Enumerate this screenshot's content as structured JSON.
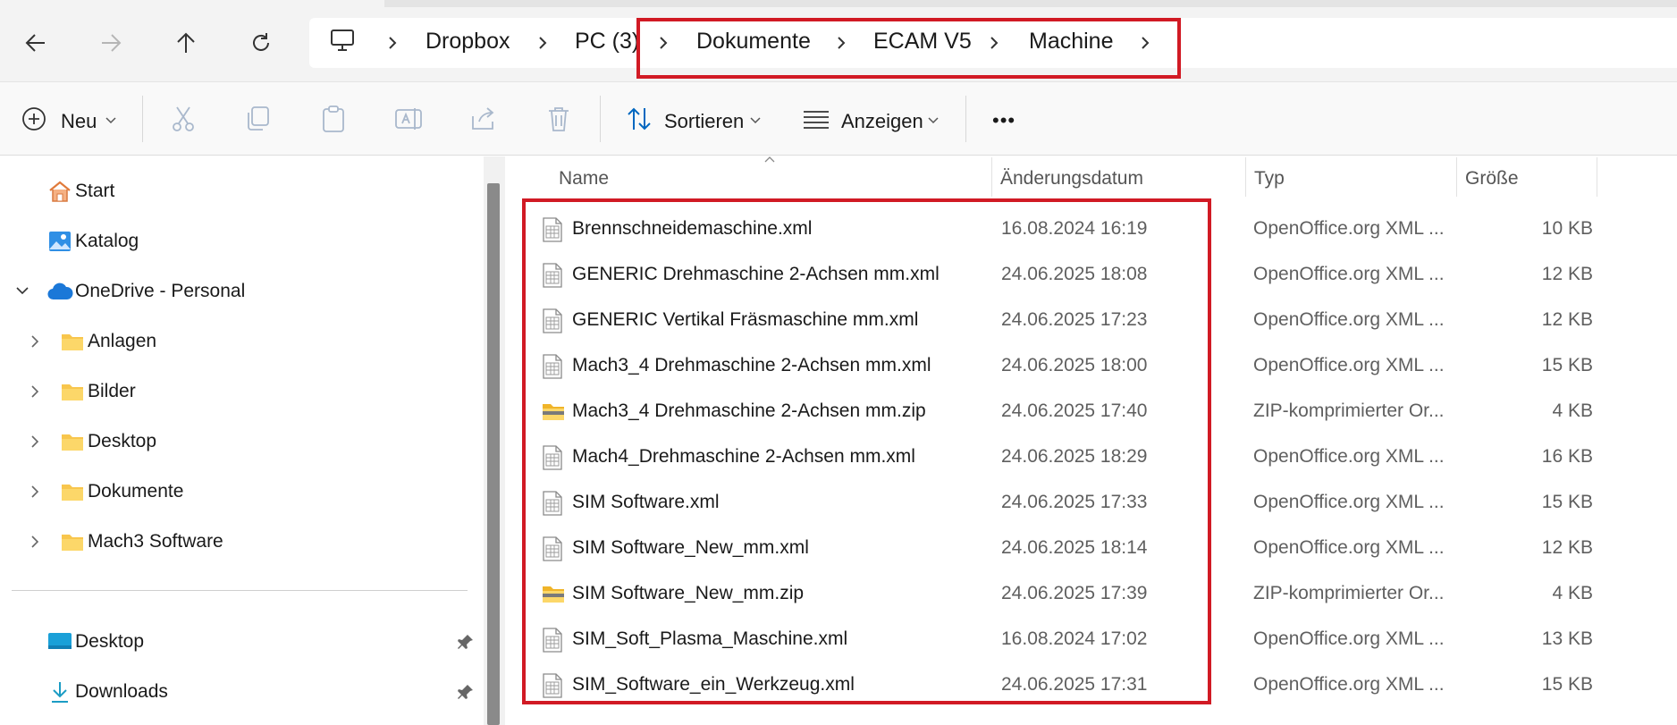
{
  "breadcrumb": [
    "Dropbox",
    "PC (3)",
    "Dokumente",
    "ECAM V5",
    "Machine"
  ],
  "toolbar": {
    "new_label": "Neu",
    "sort_label": "Sortieren",
    "view_label": "Anzeigen",
    "more_label": "•••"
  },
  "sidebar": {
    "items": [
      {
        "label": "Start",
        "icon": "home-icon"
      },
      {
        "label": "Katalog",
        "icon": "gallery-icon"
      },
      {
        "label": "OneDrive - Personal",
        "icon": "onedrive-cloud-icon"
      },
      {
        "label": "Anlagen",
        "icon": "folder-icon"
      },
      {
        "label": "Bilder",
        "icon": "folder-icon"
      },
      {
        "label": "Desktop",
        "icon": "folder-icon"
      },
      {
        "label": "Dokumente",
        "icon": "folder-icon"
      },
      {
        "label": "Mach3 Software",
        "icon": "folder-icon"
      }
    ],
    "quick_access": [
      {
        "label": "Desktop",
        "icon": "desktop-icon",
        "pinned": true
      },
      {
        "label": "Downloads",
        "icon": "download-icon",
        "pinned": true
      }
    ]
  },
  "columns": {
    "name": "Name",
    "date": "Änderungsdatum",
    "type": "Typ",
    "size": "Größe"
  },
  "files": [
    {
      "name": "Brennschneidemaschine.xml",
      "date": "16.08.2024 16:19",
      "type": "OpenOffice.org XML ...",
      "size": "10 KB",
      "icon": "xml-file-icon"
    },
    {
      "name": "GENERIC Drehmaschine 2-Achsen mm.xml",
      "date": "24.06.2025 18:08",
      "type": "OpenOffice.org XML ...",
      "size": "12 KB",
      "icon": "xml-file-icon"
    },
    {
      "name": "GENERIC Vertikal Fräsmaschine mm.xml",
      "date": "24.06.2025 17:23",
      "type": "OpenOffice.org XML ...",
      "size": "12 KB",
      "icon": "xml-file-icon"
    },
    {
      "name": "Mach3_4 Drehmaschine 2-Achsen mm.xml",
      "date": "24.06.2025 18:00",
      "type": "OpenOffice.org XML ...",
      "size": "15 KB",
      "icon": "xml-file-icon"
    },
    {
      "name": "Mach3_4 Drehmaschine 2-Achsen mm.zip",
      "date": "24.06.2025 17:40",
      "type": "ZIP-komprimierter Or...",
      "size": "4 KB",
      "icon": "zip-folder-icon"
    },
    {
      "name": "Mach4_Drehmaschine 2-Achsen mm.xml",
      "date": "24.06.2025 18:29",
      "type": "OpenOffice.org XML ...",
      "size": "16 KB",
      "icon": "xml-file-icon"
    },
    {
      "name": "SIM Software.xml",
      "date": "24.06.2025 17:33",
      "type": "OpenOffice.org XML ...",
      "size": "15 KB",
      "icon": "xml-file-icon"
    },
    {
      "name": "SIM Software_New_mm.xml",
      "date": "24.06.2025 18:14",
      "type": "OpenOffice.org XML ...",
      "size": "12 KB",
      "icon": "xml-file-icon"
    },
    {
      "name": "SIM Software_New_mm.zip",
      "date": "24.06.2025 17:39",
      "type": "ZIP-komprimierter Or...",
      "size": "4 KB",
      "icon": "zip-folder-icon"
    },
    {
      "name": "SIM_Soft_Plasma_Maschine.xml",
      "date": "16.08.2024 17:02",
      "type": "OpenOffice.org XML ...",
      "size": "13 KB",
      "icon": "xml-file-icon"
    },
    {
      "name": "SIM_Software_ein_Werkzeug.xml",
      "date": "24.06.2025 17:31",
      "type": "OpenOffice.org XML ...",
      "size": "15 KB",
      "icon": "xml-file-icon"
    }
  ],
  "colors": {
    "highlight": "#d11a24",
    "accent": "#0067c0",
    "folder": "#f8c64d"
  }
}
